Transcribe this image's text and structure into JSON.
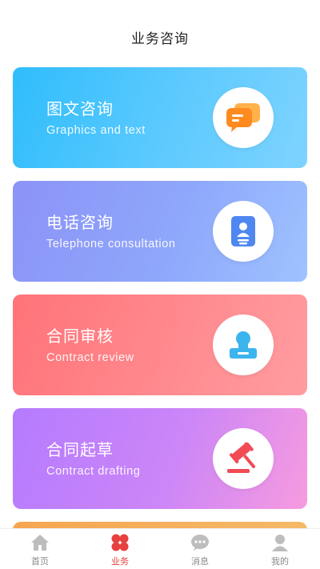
{
  "header": {
    "title": "业务咨询"
  },
  "cards": [
    {
      "title": "图文咨询",
      "subtitle": "Graphics and text",
      "icon": "chat-bubbles-icon"
    },
    {
      "title": "电话咨询",
      "subtitle": "Telephone consultation",
      "icon": "contact-card-icon"
    },
    {
      "title": "合同审核",
      "subtitle": "Contract review",
      "icon": "stamp-icon"
    },
    {
      "title": "合同起草",
      "subtitle": "Contract drafting",
      "icon": "gavel-icon"
    }
  ],
  "tabbar": {
    "tabs": [
      {
        "label": "首页",
        "icon": "home-icon",
        "active": false
      },
      {
        "label": "业务",
        "icon": "clover-icon",
        "active": true
      },
      {
        "label": "消息",
        "icon": "message-icon",
        "active": false
      },
      {
        "label": "我的",
        "icon": "profile-icon",
        "active": false
      }
    ]
  },
  "colors": {
    "active_tab": "#e8403e",
    "inactive_tab": "#8a8a8a",
    "card_1": "#2fbdfc",
    "card_2": "#8c93f7",
    "card_3": "#ff7378",
    "card_4": "#b57bff",
    "card_5": "#f6a650"
  }
}
